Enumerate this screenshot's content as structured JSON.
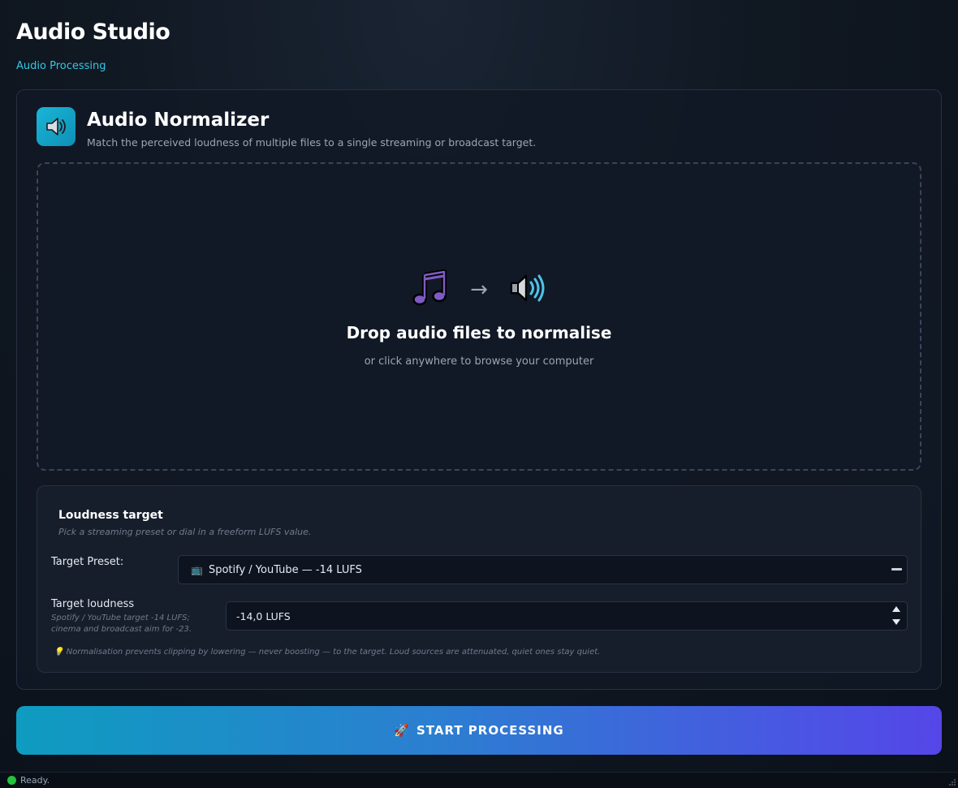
{
  "app": {
    "title": "Audio Studio",
    "subtitle": "Audio Processing"
  },
  "tool": {
    "icon": "speaker-icon",
    "title": "Audio Normalizer",
    "description": "Match the perceived loudness of multiple files to a single streaming or broadcast target."
  },
  "dropzone": {
    "icons": [
      "music-note-icon",
      "arrow-right-icon",
      "speaker-waves-icon"
    ],
    "arrow": "→",
    "title": "Drop audio files to normalise",
    "subtitle": "or click anywhere to browse your computer"
  },
  "settings": {
    "title": "Loudness target",
    "description": "Pick a streaming preset or dial in a freeform LUFS value.",
    "preset": {
      "label": "Target Preset:",
      "icon": "tv-icon",
      "tv_glyph": "📺",
      "value": "Spotify / YouTube — -14 LUFS"
    },
    "loudness": {
      "label": "Target loudness",
      "hint": "Spotify / YouTube target -14 LUFS; cinema and broadcast aim for -23.",
      "value": "-14,0 LUFS"
    },
    "footnote_glyph": "💡",
    "footnote": "Normalisation prevents clipping by lowering — never boosting — to the target. Loud sources are attenuated, quiet ones stay quiet."
  },
  "start_button": {
    "icon": "rocket-icon",
    "glyph": "🚀",
    "label": "START PROCESSING"
  },
  "status": {
    "text": "Ready."
  },
  "colors": {
    "accent_cyan": "#35c7e6",
    "button_start": "#0e9cc0",
    "button_end": "#5546e8",
    "status_ok": "#22c43a",
    "music_note": "#7e5bc4"
  }
}
